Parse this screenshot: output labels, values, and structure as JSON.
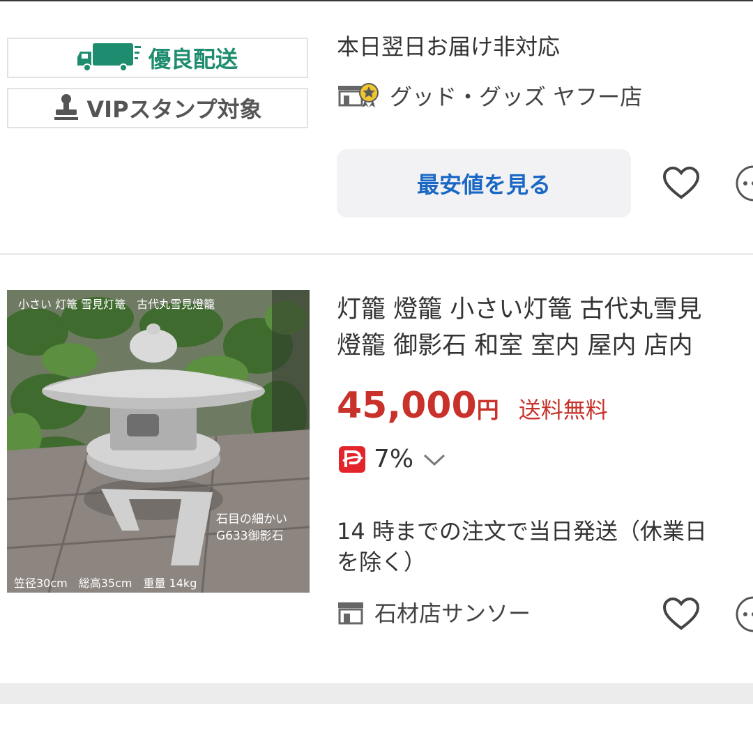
{
  "item1": {
    "badges": {
      "good_shipping": "優良配送",
      "vip_stamp": "VIPスタンプ対象"
    },
    "delivery_note": "本日翌日お届け非対応",
    "store_name": "グッド・グッズ ヤフー店",
    "cheapest_button": "最安値を見る",
    "icons": [
      "truck-icon",
      "stamp-icon",
      "store-badge-icon",
      "heart-icon",
      "more-icon"
    ]
  },
  "item2": {
    "photo_captions": {
      "top": "小さい 灯篭 雪見灯篭　古代丸雪見燈籠",
      "stone": "石目の細かい",
      "material": "G633御影石",
      "dimensions": "笠径30cm　総高35cm　重量 14kg"
    },
    "title_line1": "灯籠 燈籠 小さい灯篭 古代丸雪見",
    "title_line2": "燈籠  御影石 和室 室内 屋内 店内",
    "price": "45,000",
    "yen": "円",
    "shipping": "送料無料",
    "points": "7%",
    "ship_note_line1": "14 時までの注文で当日発送（休業日",
    "ship_note_line2": "を除く）",
    "store_name": "石材店サンソー",
    "icons": [
      "paypay-icon",
      "chevron-down-icon",
      "store-icon",
      "heart-icon",
      "more-icon"
    ]
  },
  "colors": {
    "accent_green": "#1e8c6e",
    "link_blue": "#1b68c4",
    "price_red": "#c8322a",
    "paypay_red": "#e3242b"
  }
}
